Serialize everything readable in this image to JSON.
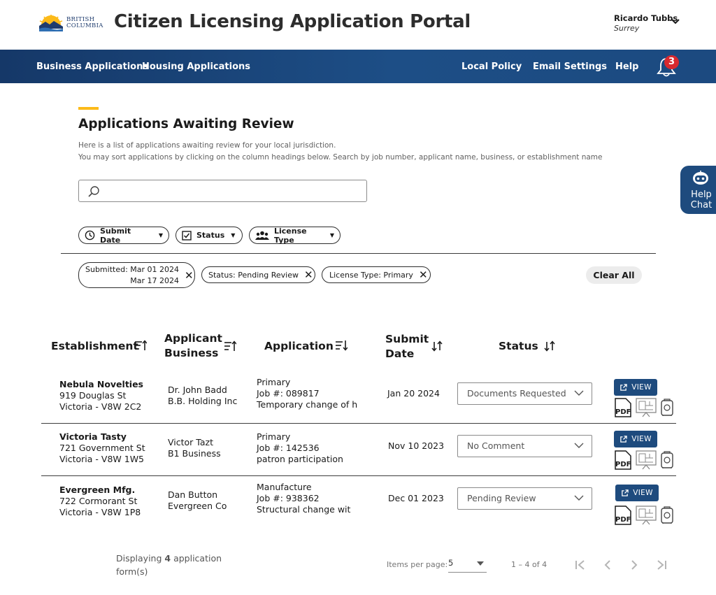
{
  "header": {
    "logo_text": "BRITISH\nCOLUMBIA",
    "title": "Citizen Licensing Application Portal",
    "user_name": "Ricardo Tubbs",
    "user_location": "Surrey"
  },
  "nav": {
    "left": [
      "Business Applications",
      "Housing Applications"
    ],
    "right": [
      "Local Policy",
      "Email Settings",
      "Help"
    ],
    "notification_count": "3"
  },
  "section": {
    "title": "Applications Awaiting Review",
    "desc_line1": "Here is a list of applications awaiting review for your local jurisdiction.",
    "desc_line2": "You may sort applications by clicking on the column headings below. Search by job number, applicant name, business, or establishment name",
    "search_placeholder": ""
  },
  "filters": {
    "submit_date": "Submit Date",
    "status": "Status",
    "license_type": "License Type"
  },
  "chips": {
    "submitted_line1": "Submitted: Mar 01 2024",
    "submitted_line2": "Mar 17 2024",
    "status": "Status: Pending Review",
    "license_type": "License Type: Primary",
    "clear_all": "Clear All"
  },
  "table": {
    "headers": {
      "establishment": "Establishment",
      "applicant_1": "Applicant",
      "applicant_2": "Business",
      "application": "Application",
      "submit_1": "Submit",
      "submit_2": "Date",
      "status": "Status"
    },
    "view_label": "VIEW",
    "rows": [
      {
        "name": "Nebula Novelties",
        "addr1": "919 Douglas St",
        "addr2": "Victoria - V8W 2C2",
        "applicant": "Dr. John Badd",
        "business": "B.B. Holding Inc",
        "app_type": "Primary",
        "job": "Job #: 089817",
        "desc": "Temporary change of h",
        "date": "Jan 20 2024",
        "status": "Documents Requested"
      },
      {
        "name": "Victoria Tasty",
        "addr1": "721 Government St",
        "addr2": "Victoria - V8W 1W5",
        "applicant": "Victor Tazt",
        "business": "B1 Business",
        "app_type": "Primary",
        "job": "Job #: 142536",
        "desc": "patron participation",
        "date": "Nov 10 2023",
        "status": "No Comment"
      },
      {
        "name": "Evergreen Mfg.",
        "addr1": "722 Cormorant St",
        "addr2": "Victoria - V8W 1P8",
        "applicant": "Dan Button",
        "business": "Evergreen Co",
        "app_type": "Manufacture",
        "job": "Job #: 938362",
        "desc": "Structural change wit",
        "date": "Dec 01 2023",
        "status": "Pending Review"
      }
    ]
  },
  "help_chat": {
    "line1": "Help",
    "line2": "Chat"
  },
  "footer": {
    "displaying_pre": "Displaying ",
    "displaying_count": "4",
    "displaying_post": " application form(s)",
    "items_per_page_label": "Items per page:",
    "items_per_page_value": "5",
    "range": "1 – 4 of 4"
  },
  "colors": {
    "nav_bg": "#153868",
    "accent": "#fcba19",
    "badge": "#d8292f",
    "button": "#1e4b7e"
  }
}
